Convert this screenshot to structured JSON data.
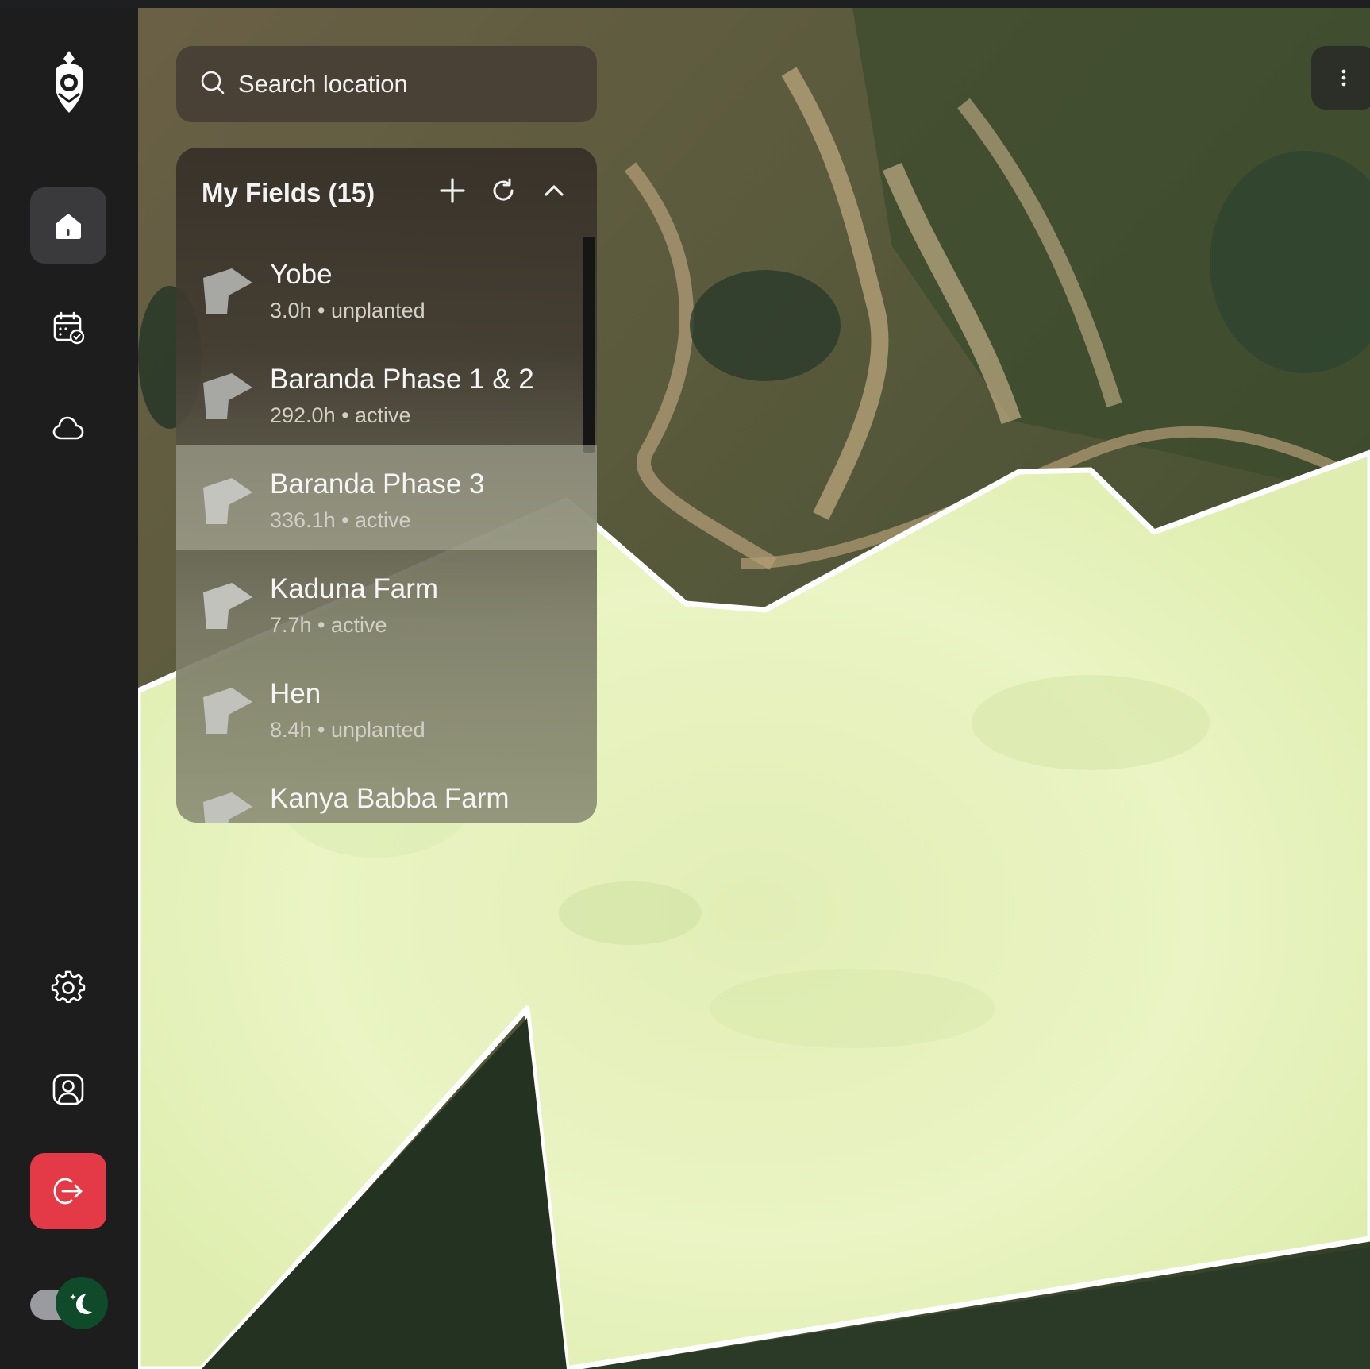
{
  "search": {
    "placeholder": "Search location"
  },
  "fields_panel": {
    "title": "My Fields (15)",
    "add_label": "add-field",
    "refresh_label": "refresh",
    "collapse_label": "collapse",
    "items": [
      {
        "name": "Yobe",
        "meta": "3.0h • unplanted",
        "selected": false
      },
      {
        "name": "Baranda Phase 1 & 2",
        "meta": "292.0h • active",
        "selected": false
      },
      {
        "name": "Baranda Phase 3",
        "meta": "336.1h • active",
        "selected": true
      },
      {
        "name": "Kaduna Farm",
        "meta": "7.7h • active",
        "selected": false
      },
      {
        "name": "Hen",
        "meta": "8.4h • unplanted",
        "selected": false
      },
      {
        "name": "Kanya Babba Farm",
        "meta": "",
        "selected": false
      }
    ]
  },
  "sidebar": {
    "items": [
      {
        "icon": "home-icon",
        "active": true
      },
      {
        "icon": "calendar-check-icon",
        "active": false
      },
      {
        "icon": "cloud-icon",
        "active": false
      },
      {
        "icon": "gear-icon",
        "active": false
      },
      {
        "icon": "user-icon",
        "active": false
      },
      {
        "icon": "logout-icon",
        "active": false
      }
    ],
    "theme_toggle": {
      "mode": "dark"
    }
  },
  "colors": {
    "sidebar_bg": "#1d1d1d",
    "active_nav": "#3a3a3c",
    "logout": "#e43a48",
    "field_overlay": "#e6f2c0",
    "toggle_knob": "#0f4a2a"
  }
}
